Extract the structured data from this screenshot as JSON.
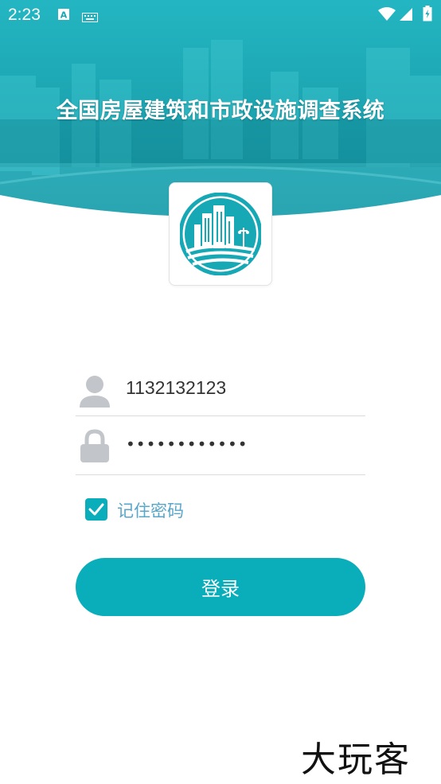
{
  "status_bar": {
    "time": "2:23",
    "icons": [
      "accessibility-icon",
      "keyboard-icon",
      "wifi-icon",
      "signal-icon",
      "battery-icon"
    ]
  },
  "header": {
    "title": "全国房屋建筑和市政设施调查系统",
    "background_color": "#1aa6b4"
  },
  "login": {
    "username_value": "1132132123",
    "password_value": "••••••••••••",
    "remember_label": "记住密码",
    "remember_checked": true,
    "login_button_label": "登录"
  },
  "watermark": {
    "text": "大玩客"
  },
  "colors": {
    "accent": "#0aaebb",
    "remember_text": "#5aa6c8",
    "icon_gray": "#c2c6ca"
  }
}
